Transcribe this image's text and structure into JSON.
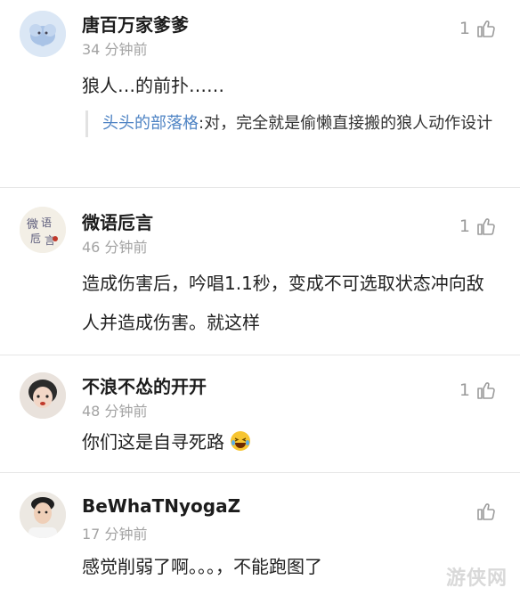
{
  "comments": [
    {
      "name": "唐百万家爹爹",
      "time": "34 分钟前",
      "likes": "1",
      "text": "狼人…的前扑……",
      "reply": {
        "name": "头头的部落格",
        "text": ":对，完全就是偷懒直接搬的狼人动作设计"
      }
    },
    {
      "name": "微语卮言",
      "time": "46 分钟前",
      "likes": "1",
      "text": "造成伤害后，吟唱1.1秒，变成不可选取状态冲向敌人并造成伤害。就这样",
      "avatar_text": "微语卮言"
    },
    {
      "name": "不浪不怂的开开",
      "time": "48 分钟前",
      "likes": "1",
      "text": "你们这是自寻死路"
    },
    {
      "name": "BeWhaTNyogaZ",
      "time": "17 分钟前",
      "likes": "",
      "text": "感觉削弱了啊。。。，不能跑图了"
    }
  ],
  "watermark": "游侠网",
  "colors": {
    "reply_name": "#4f84c4",
    "muted": "#a3a3a3",
    "divider": "#e6e6e6"
  }
}
